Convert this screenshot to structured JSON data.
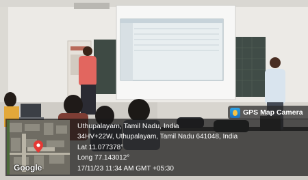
{
  "camera_tag": {
    "label": "GPS Map Camera",
    "icon": "gps-map-camera-icon"
  },
  "location": {
    "title": "Uthupalayam, Tamil Nadu, India",
    "address": "34HV+22W, Uthupalayam, Tamil Nadu 641048, India",
    "latitude": "Lat 11.077378°",
    "longitude": "Long 77.143012°",
    "timestamp": "17/11/23 11:34 AM GMT +05:30"
  },
  "map": {
    "logo": "Google",
    "pin_color": "#e53935"
  },
  "colors": {
    "overlay": "#191919",
    "wall": "#f2f2f0",
    "board": "#3f4a45"
  }
}
